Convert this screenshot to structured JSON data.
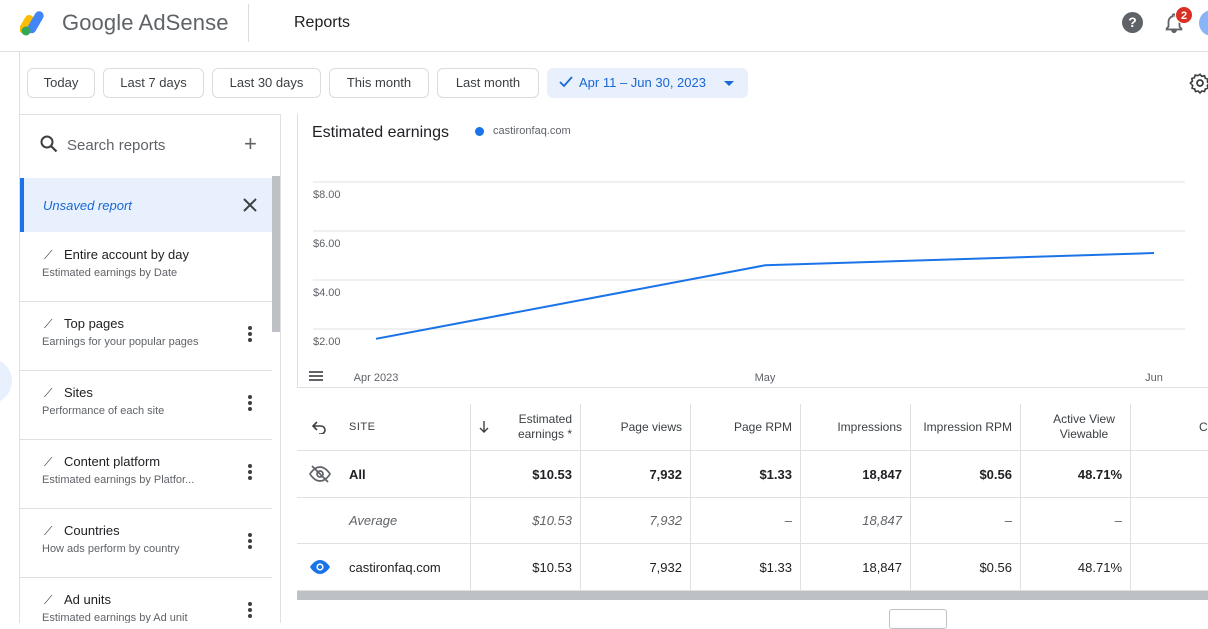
{
  "header": {
    "brand": "Google AdSense",
    "title": "Reports",
    "help": "?",
    "notification_count": "2",
    "colors": {
      "logo_yellow": "#fbbc04",
      "logo_green": "#34a853",
      "logo_blue": "#4285f4"
    }
  },
  "filters": {
    "chips": [
      "Today",
      "Last 7 days",
      "Last 30 days",
      "This month",
      "Last month"
    ],
    "active_range": "Apr 11 – Jun 30, 2023"
  },
  "sidebar": {
    "search_placeholder": "Search reports",
    "unsaved_label": "Unsaved report",
    "items": [
      {
        "title": "Entire account by day",
        "subtitle": "Estimated earnings by Date",
        "has_menu": false
      },
      {
        "title": "Top pages",
        "subtitle": "Earnings for your popular pages",
        "has_menu": true
      },
      {
        "title": "Sites",
        "subtitle": "Performance of each site",
        "has_menu": true
      },
      {
        "title": "Content platform",
        "subtitle": "Estimated earnings by Platfor...",
        "has_menu": true
      },
      {
        "title": "Countries",
        "subtitle": "How ads perform by country",
        "has_menu": true
      },
      {
        "title": "Ad units",
        "subtitle": "Estimated earnings by Ad unit",
        "has_menu": true
      }
    ]
  },
  "chart_data": {
    "type": "line",
    "title": "Estimated earnings",
    "x_labels": [
      "Apr 2023",
      "May",
      "Jun"
    ],
    "y_ticks": [
      "$8.00",
      "$6.00",
      "$4.00",
      "$2.00"
    ],
    "ylim": [
      0,
      8
    ],
    "series": [
      {
        "name": "castironfaq.com",
        "color": "#1a73e8",
        "points": [
          {
            "x": "Apr 2023",
            "y": 1.6
          },
          {
            "x": "May",
            "y": 4.6
          },
          {
            "x": "Jun",
            "y": 5.1
          }
        ]
      }
    ]
  },
  "table": {
    "headers": [
      "SITE",
      "Estimated earnings *",
      "Page views",
      "Page RPM",
      "Impressions",
      "Impression RPM",
      "Active View Viewable",
      "Cl"
    ],
    "rows": [
      {
        "kind": "all",
        "site": "All",
        "earnings": "$10.53",
        "page_views": "7,932",
        "page_rpm": "$1.33",
        "impressions": "18,847",
        "impression_rpm": "$0.56",
        "active_view": "48.71%"
      },
      {
        "kind": "average",
        "site": "Average",
        "earnings": "$10.53",
        "page_views": "7,932",
        "page_rpm": "–",
        "impressions": "18,847",
        "impression_rpm": "–",
        "active_view": "–"
      },
      {
        "kind": "site",
        "site": "castironfaq.com",
        "earnings": "$10.53",
        "page_views": "7,932",
        "page_rpm": "$1.33",
        "impressions": "18,847",
        "impression_rpm": "$0.56",
        "active_view": "48.71%"
      }
    ]
  }
}
